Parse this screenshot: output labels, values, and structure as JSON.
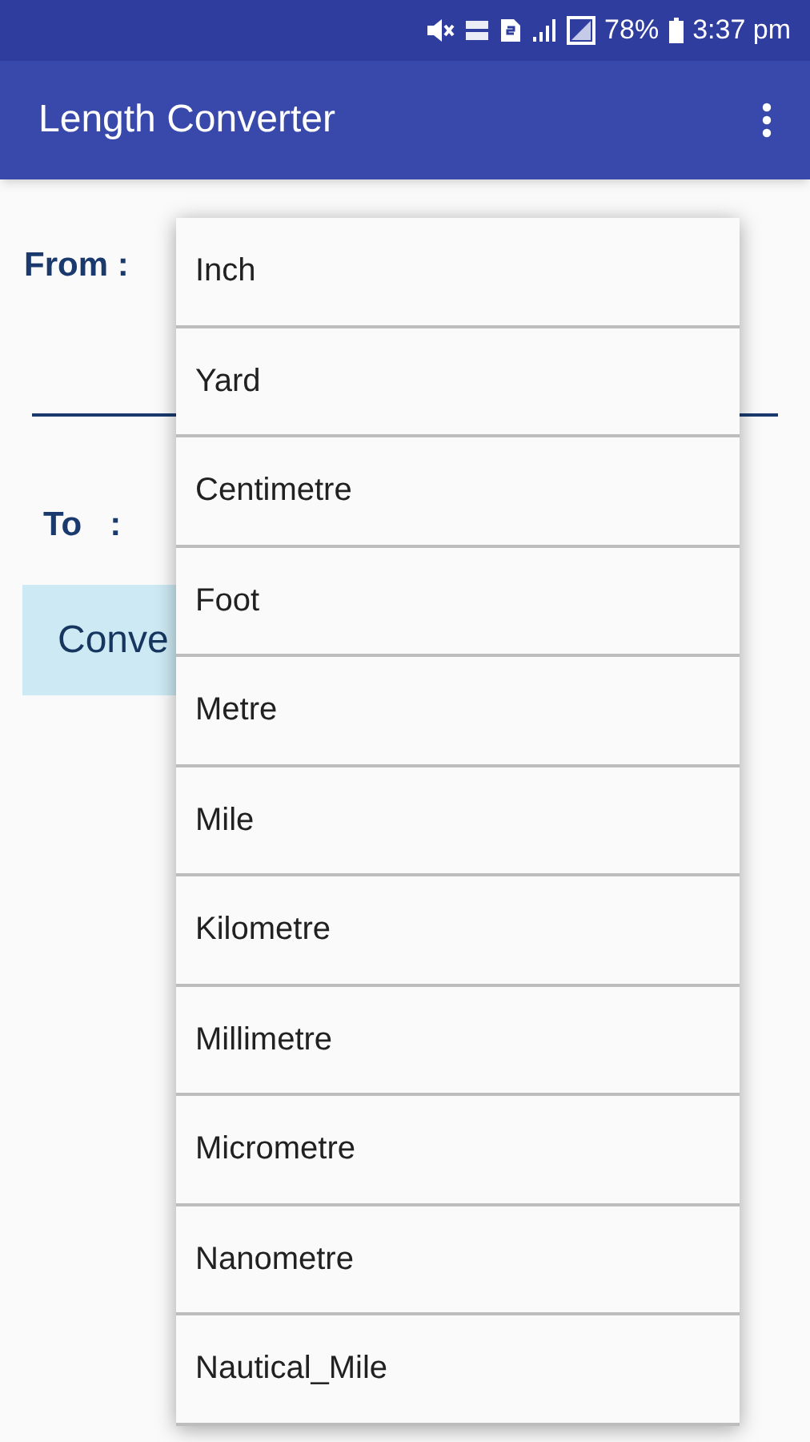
{
  "status_bar": {
    "battery": "78%",
    "time": "3:37 pm"
  },
  "app_bar": {
    "title": "Length Converter"
  },
  "form": {
    "from_label": "From :",
    "to_label": "To   :",
    "convert_button": "Conve"
  },
  "dropdown": {
    "items": [
      {
        "label": "Inch"
      },
      {
        "label": "Yard"
      },
      {
        "label": "Centimetre"
      },
      {
        "label": "Foot"
      },
      {
        "label": "Metre"
      },
      {
        "label": "Mile"
      },
      {
        "label": "Kilometre"
      },
      {
        "label": "Millimetre"
      },
      {
        "label": "Micrometre"
      },
      {
        "label": "Nanometre"
      },
      {
        "label": "Nautical_Mile"
      }
    ]
  }
}
